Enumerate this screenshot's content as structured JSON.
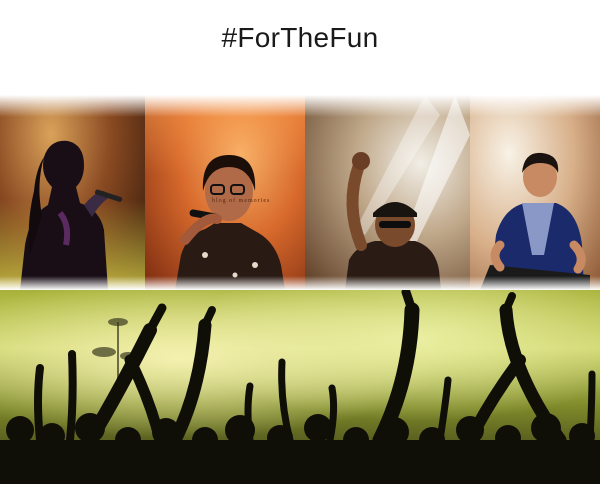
{
  "page": {
    "title": "#ForTheFun",
    "watermark": "blog of memories"
  },
  "images": [
    {
      "name": "singer-woman-panel-photo"
    },
    {
      "name": "singer-glasses-panel-photo"
    },
    {
      "name": "singer-cap-panel-photo"
    },
    {
      "name": "keyboard-player-panel-photo"
    },
    {
      "name": "concert-crowd-photo"
    }
  ]
}
